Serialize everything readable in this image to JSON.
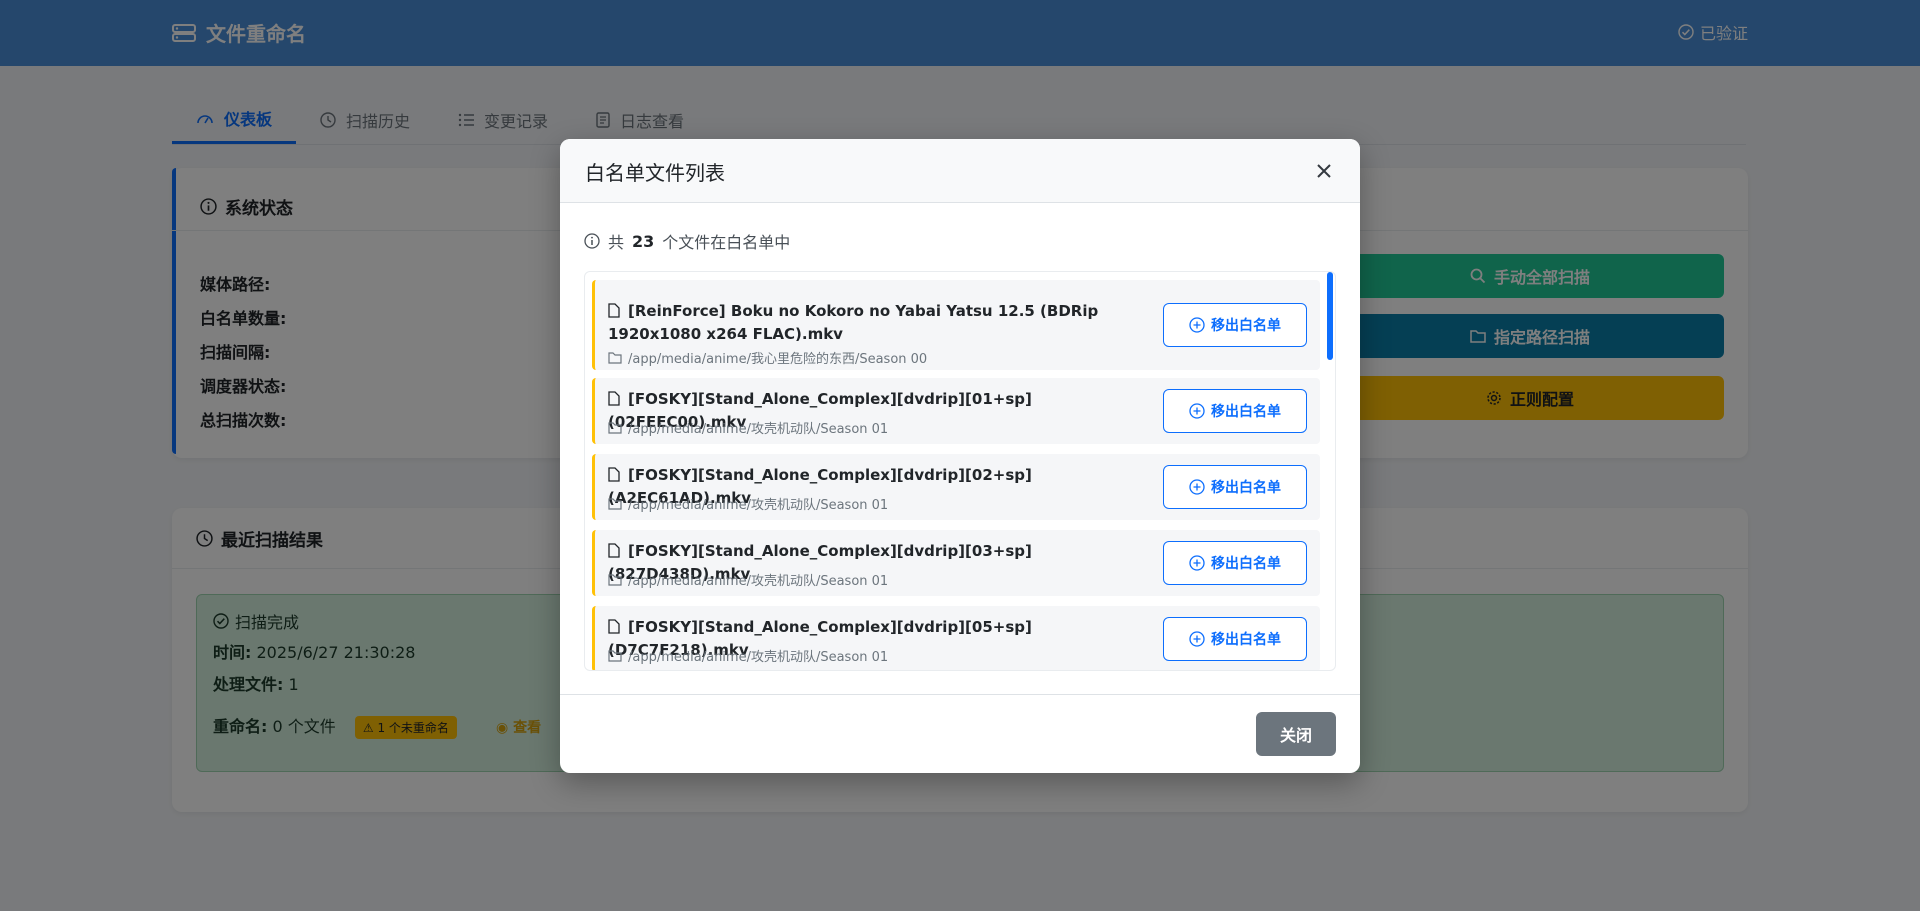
{
  "header": {
    "title": "文件重命名",
    "verified": "已验证"
  },
  "tabs": [
    {
      "label": "仪表板",
      "active": true
    },
    {
      "label": "扫描历史"
    },
    {
      "label": "变更记录"
    },
    {
      "label": "日志查看"
    }
  ],
  "status_card": {
    "title": "系统状态",
    "labels": [
      "媒体路径:",
      "白名单数量:",
      "扫描间隔:",
      "调度器状态:",
      "总扫描次数:"
    ],
    "actions": {
      "scan_all": "手动全部扫描",
      "scan_path": "指定路径扫描",
      "regex_config": "正则配置"
    }
  },
  "recent_card": {
    "title": "最近扫描结果",
    "result": {
      "status": "扫描完成",
      "time_label": "时间:",
      "time_value": "2025/6/27 21:30:28",
      "processed_label": "处理文件:",
      "processed_value": "1",
      "renamed_label": "重命名:",
      "renamed_value": "0 个文件",
      "badge": "1 个未重命名",
      "view": "查看"
    }
  },
  "modal": {
    "title": "白名单文件列表",
    "info_prefix": "共",
    "info_count": "23",
    "info_suffix": "个文件在白名单中",
    "remove_label": "移出白名单",
    "close_label": "关闭",
    "items": [
      {
        "name": "[ReinForce] Boku no Kokoro no Yabai Yatsu 12.5 (BDRip 1920x1080 x264 FLAC).mkv",
        "path": "/app/media/anime/我心里危险的东西/Season 00"
      },
      {
        "name": "[FOSKY][Stand_Alone_Complex][dvdrip][01+sp](02FEEC00).mkv",
        "path": "/app/media/anime/攻壳机动队/Season 01"
      },
      {
        "name": "[FOSKY][Stand_Alone_Complex][dvdrip][02+sp](A2EC61AD).mkv",
        "path": "/app/media/anime/攻壳机动队/Season 01"
      },
      {
        "name": "[FOSKY][Stand_Alone_Complex][dvdrip][03+sp](827D438D).mkv",
        "path": "/app/media/anime/攻壳机动队/Season 01"
      },
      {
        "name": "[FOSKY][Stand_Alone_Complex][dvdrip][05+sp](D7C7F218).mkv",
        "path": "/app/media/anime/攻壳机动队/Season 01"
      }
    ]
  }
}
